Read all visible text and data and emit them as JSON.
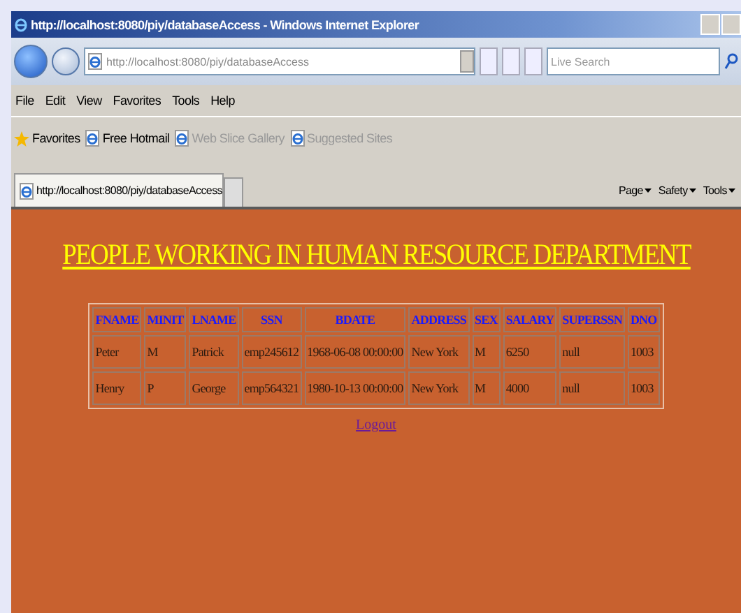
{
  "window": {
    "title": "http://localhost:8080/piy/databaseAccess - Windows Internet Explorer"
  },
  "address_bar": {
    "url": "http://localhost:8080/piy/databaseAccess",
    "search_placeholder": "Live Search"
  },
  "menu": [
    "File",
    "Edit",
    "View",
    "Favorites",
    "Tools",
    "Help"
  ],
  "favorites_bar": [
    {
      "label": "Favorites",
      "kind": "star",
      "disabled": false
    },
    {
      "label": "Free Hotmail",
      "kind": "ie",
      "disabled": false
    },
    {
      "label": "Web Slice Gallery",
      "kind": "ie",
      "disabled": true
    },
    {
      "label": "Suggested Sites",
      "kind": "ie",
      "disabled": true
    }
  ],
  "tab": {
    "title": "http://localhost:8080/piy/databaseAccess"
  },
  "command_bar": [
    "Page",
    "Safety",
    "Tools"
  ],
  "page": {
    "heading": "PEOPLE WORKING IN HUMAN RESOURCE DEPARTMENT",
    "table": {
      "columns": [
        "FNAME",
        "MINIT",
        "LNAME",
        "SSN",
        "BDATE",
        "ADDRESS",
        "SEX",
        "SALARY",
        "SUPERSSN",
        "DNO"
      ],
      "rows": [
        [
          "Peter",
          "M",
          "Patrick",
          "emp245612",
          "1968-06-08 00:00:00",
          "New York",
          "M",
          "6250",
          "null",
          "1003"
        ],
        [
          "Henry",
          "P",
          "George",
          "emp564321",
          "1980-10-13 00:00:00",
          "New York",
          "M",
          "4000",
          "null",
          "1003"
        ]
      ]
    },
    "link": "Logout"
  }
}
